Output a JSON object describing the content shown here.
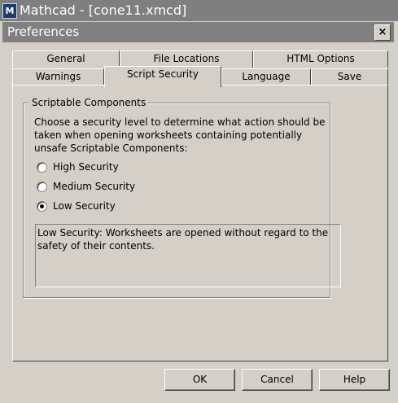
{
  "app": {
    "title": "Mathcad - [cone11.xmcd]"
  },
  "dialog": {
    "title": "Preferences",
    "close_label": "×",
    "tabs_back_row": [
      {
        "label": "General"
      },
      {
        "label": "File Locations"
      },
      {
        "label": "HTML Options"
      }
    ],
    "tabs_front_row": [
      {
        "label": "Warnings"
      },
      {
        "label": "Script Security",
        "active": true
      },
      {
        "label": "Language"
      },
      {
        "label": "Save"
      }
    ],
    "group": {
      "legend": "Scriptable Components",
      "description": "Choose a security level to determine what action should be taken when opening worksheets containing potentially unsafe Scriptable Components:",
      "options": [
        {
          "label": "High Security",
          "selected": false
        },
        {
          "label": "Medium Security",
          "selected": false
        },
        {
          "label": "Low Security",
          "selected": true
        }
      ],
      "info_text": "Low Security:  Worksheets are opened without regard to the safety of their contents."
    },
    "buttons": {
      "ok": "OK",
      "cancel": "Cancel",
      "help": "Help"
    }
  }
}
